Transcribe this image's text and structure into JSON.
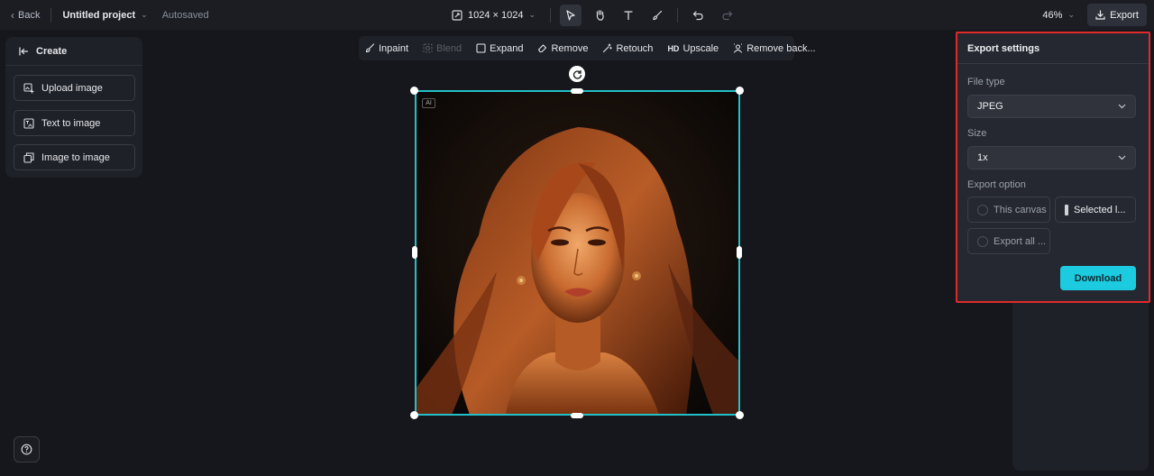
{
  "topbar": {
    "back_label": "Back",
    "project_name": "Untitled project",
    "autosave_status": "Autosaved",
    "canvas_size": "1024 × 1024",
    "zoom": "46%",
    "export_label": "Export"
  },
  "create_panel": {
    "title": "Create",
    "items": [
      {
        "label": "Upload image",
        "icon": "upload-image-icon"
      },
      {
        "label": "Text to image",
        "icon": "text-to-image-icon"
      },
      {
        "label": "Image to image",
        "icon": "image-to-image-icon"
      }
    ]
  },
  "edit_toolbar": {
    "items": [
      {
        "label": "Inpaint",
        "icon": "brush-icon",
        "disabled": false
      },
      {
        "label": "Blend",
        "icon": "blend-icon",
        "disabled": true
      },
      {
        "label": "Expand",
        "icon": "expand-icon",
        "disabled": false
      },
      {
        "label": "Remove",
        "icon": "eraser-icon",
        "disabled": false
      },
      {
        "label": "Retouch",
        "icon": "retouch-icon",
        "disabled": false
      },
      {
        "label": "Upscale",
        "icon": "hd-icon",
        "disabled": false
      },
      {
        "label": "Remove back...",
        "icon": "remove-background-icon",
        "disabled": false
      }
    ],
    "hd_glyph": "HD"
  },
  "canvas": {
    "ai_badge": "AI"
  },
  "export_settings": {
    "title": "Export settings",
    "file_type_label": "File type",
    "file_type_value": "JPEG",
    "size_label": "Size",
    "size_value": "1x",
    "export_option_label": "Export option",
    "options": [
      {
        "label": "This canvas",
        "selected": false
      },
      {
        "label": "Selected l...",
        "selected": true
      },
      {
        "label": "Export all ...",
        "selected": false
      }
    ],
    "download_label": "Download"
  },
  "colors": {
    "accent": "#1ccbe0",
    "selection": "#24bfc7",
    "highlight_border": "#e02a2a"
  }
}
